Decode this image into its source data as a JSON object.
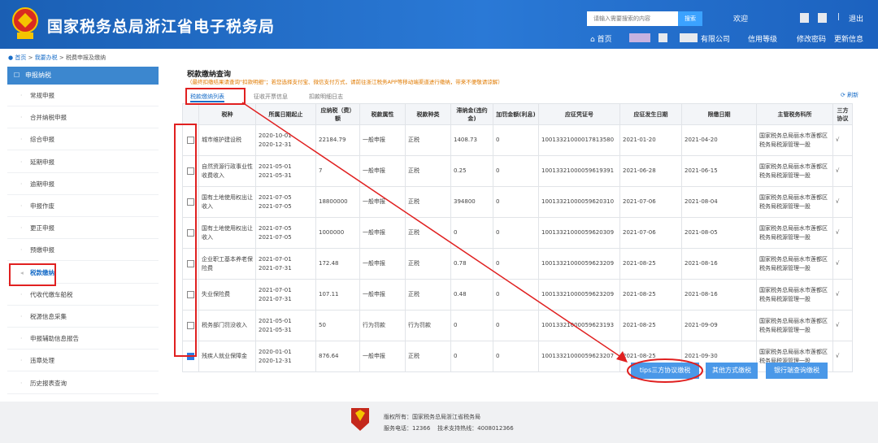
{
  "header": {
    "site_title": "国家税务总局浙江省电子税务局",
    "search_placeholder": "请输入需要搜索的内容",
    "search_button": "搜索",
    "welcome": "欢迎",
    "separator": "|",
    "logout": "退出",
    "home": "首页",
    "company": "有限公司",
    "credit_rating": "信用等级",
    "change_password": "修改密码",
    "update_info": "更新信息"
  },
  "breadcrumb": {
    "home": "首页",
    "sep": ">",
    "my_office": "我要办税",
    "current": "税费申报及缴纳"
  },
  "sidebar": {
    "title": "申报纳税",
    "items": [
      "常规申报",
      "合并纳税申报",
      "综合申报",
      "延期申报",
      "逾期申报",
      "申报作废",
      "更正申报",
      "预缴申报",
      "税款缴纳",
      "代收代缴车船税",
      "税源信息采集",
      "申报辅助信息报告",
      "违章处理",
      "历史报表查询"
    ]
  },
  "main": {
    "title": "税款缴纳查询",
    "notice": "（最终扣缴结果请查询\"扣款明细\"；若您选择支付宝、微信支付方式，请前往浙江税务APP等移动端渠道进行缴纳，带来不便敬请谅解）",
    "tabs": [
      "税款缴纳列表",
      "征收开票信息",
      "扣款明细日志"
    ],
    "refresh": "刷新",
    "columns": [
      "税种",
      "所属日期起止",
      "应纳税（费）额",
      "税款属性",
      "税款种类",
      "滞纳金(违约金)",
      "加罚金额(利息)",
      "应征凭证号",
      "应征发生日期",
      "限缴日期",
      "主管税务科所",
      "三方协议"
    ],
    "rows": [
      {
        "checked": false,
        "tax": "城市维护建设税",
        "period_start": "2020-10-01",
        "period_end": "2020-12-31",
        "amount": "22184.79",
        "attr": "一般申报",
        "kind": "正税",
        "late_fee": "1408.73",
        "penalty": "0",
        "voucher": "10013321000017813580",
        "occur": "2021-01-20",
        "deadline": "2021-04-20",
        "office": "国家税务总局丽水市莲都区税务局税源管理一股",
        "tripartite": "√"
      },
      {
        "checked": false,
        "tax": "自然资源行政事业性收费收入",
        "period_start": "2021-05-01",
        "period_end": "2021-05-31",
        "amount": "7",
        "attr": "一般申报",
        "kind": "正税",
        "late_fee": "0.25",
        "penalty": "0",
        "voucher": "10013321000059619391",
        "occur": "2021-06-28",
        "deadline": "2021-06-15",
        "office": "国家税务总局丽水市莲都区税务局税源管理一股",
        "tripartite": "√"
      },
      {
        "checked": false,
        "tax": "国有土地使用权出让收入",
        "period_start": "2021-07-05",
        "period_end": "2021-07-05",
        "amount": "18800000",
        "attr": "一般申报",
        "kind": "正税",
        "late_fee": "394800",
        "penalty": "0",
        "voucher": "10013321000059620310",
        "occur": "2021-07-06",
        "deadline": "2021-08-04",
        "office": "国家税务总局丽水市莲都区税务局税源管理一股",
        "tripartite": "√"
      },
      {
        "checked": false,
        "tax": "国有土地使用权出让收入",
        "period_start": "2021-07-05",
        "period_end": "2021-07-05",
        "amount": "1000000",
        "attr": "一般申报",
        "kind": "正税",
        "late_fee": "0",
        "penalty": "0",
        "voucher": "10013321000059620309",
        "occur": "2021-07-06",
        "deadline": "2021-08-05",
        "office": "国家税务总局丽水市莲都区税务局税源管理一股",
        "tripartite": "√"
      },
      {
        "checked": false,
        "tax": "企业职工基本养老保险费",
        "period_start": "2021-07-01",
        "period_end": "2021-07-31",
        "amount": "172.48",
        "attr": "一般申报",
        "kind": "正税",
        "late_fee": "0.78",
        "penalty": "0",
        "voucher": "10013321000059623209",
        "occur": "2021-08-25",
        "deadline": "2021-08-16",
        "office": "国家税务总局丽水市莲都区税务局税源管理一股",
        "tripartite": "√"
      },
      {
        "checked": false,
        "tax": "失业保险费",
        "period_start": "2021-07-01",
        "period_end": "2021-07-31",
        "amount": "107.11",
        "attr": "一般申报",
        "kind": "正税",
        "late_fee": "0.48",
        "penalty": "0",
        "voucher": "10013321000059623209",
        "occur": "2021-08-25",
        "deadline": "2021-08-16",
        "office": "国家税务总局丽水市莲都区税务局税源管理一股",
        "tripartite": "√"
      },
      {
        "checked": false,
        "tax": "税务部门罚没收入",
        "period_start": "2021-05-01",
        "period_end": "2021-05-31",
        "amount": "50",
        "attr": "行为罚款",
        "kind": "行为罚款",
        "late_fee": "0",
        "penalty": "0",
        "voucher": "10013321000059623193",
        "occur": "2021-08-25",
        "deadline": "2021-09-09",
        "office": "国家税务总局丽水市莲都区税务局税源管理一股",
        "tripartite": "√"
      },
      {
        "checked": true,
        "tax": "残疾人就业保障金",
        "period_start": "2020-01-01",
        "period_end": "2020-12-31",
        "amount": "876.64",
        "attr": "一般申报",
        "kind": "正税",
        "late_fee": "0",
        "penalty": "0",
        "voucher": "10013321000059623207",
        "occur": "2021-08-25",
        "deadline": "2021-09-30",
        "office": "国家税务总局丽水市莲都区税务局税源管理一股",
        "tripartite": "√"
      }
    ],
    "buttons": {
      "tips": "tips三方协议缴税",
      "other": "其他方式缴税",
      "bank": "银行端查询缴税"
    }
  },
  "footer": {
    "copyright": "版权所有：国家税务总局浙江省税务局",
    "contact": "服务电话：12366    技术支持热线：4008012366"
  },
  "colors": {
    "header_blue": "#1a5fb4",
    "annotation_red": "#e02020",
    "button_blue": "#4a98e8",
    "link_blue": "#1a6ec8"
  }
}
